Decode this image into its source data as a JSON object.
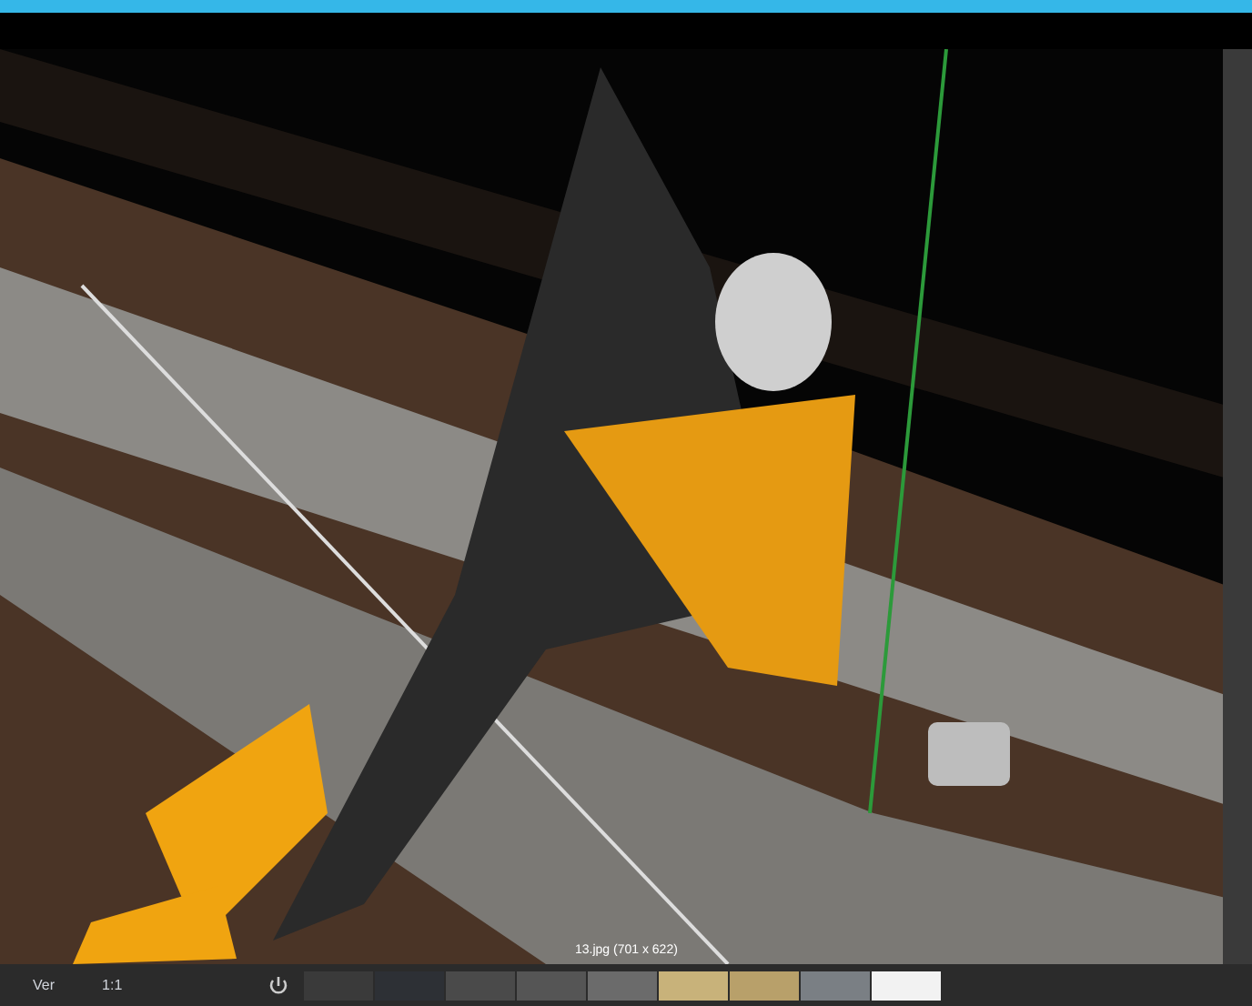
{
  "viewport": {
    "kind": "picture",
    "caption": "13.jpg (701 x 622)"
  },
  "bottom_bar": {
    "labels": [
      "Ver",
      "1:1"
    ]
  }
}
